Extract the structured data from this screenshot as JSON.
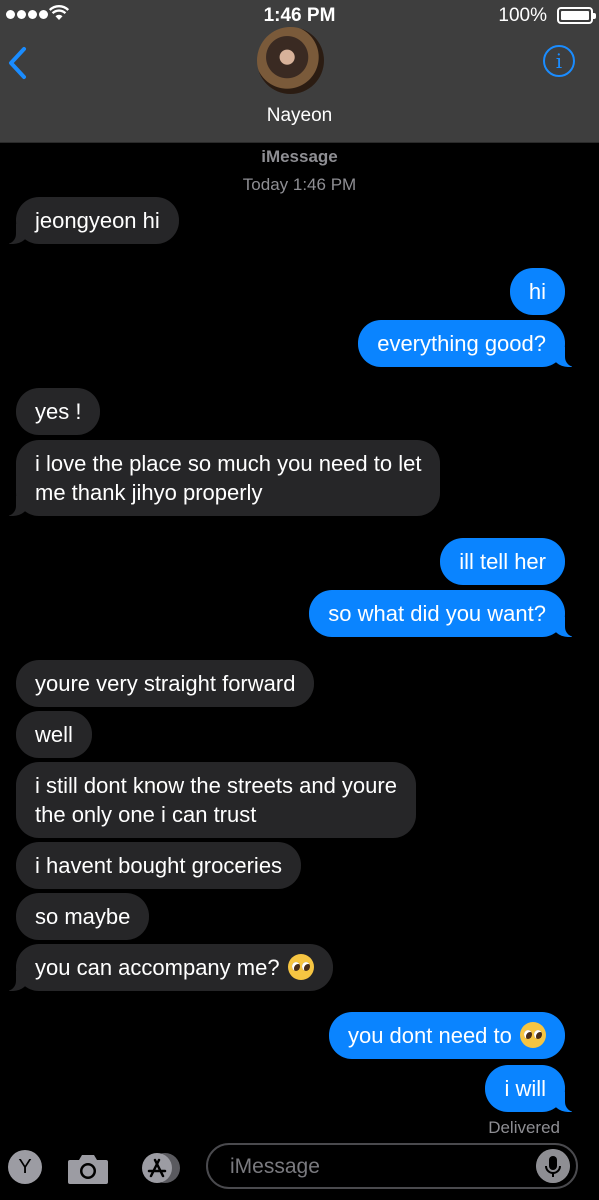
{
  "status_bar": {
    "time": "1:46 PM",
    "battery": "100%"
  },
  "header": {
    "contact_name": "Nayeon",
    "info_label": "i"
  },
  "conversation": {
    "service": "iMessage",
    "timestamp": "Today 1:46 PM",
    "messages": [
      {
        "from": "them",
        "text": "jeongyeon hi"
      },
      {
        "from": "me",
        "text": "hi"
      },
      {
        "from": "me",
        "text": "everything good?"
      },
      {
        "from": "them",
        "text": "yes !"
      },
      {
        "from": "them",
        "text": "i love the place so much you need to let",
        "text2": "me thank jihyo properly"
      },
      {
        "from": "me",
        "text": "ill tell her"
      },
      {
        "from": "me",
        "text": "so what did you want?"
      },
      {
        "from": "them",
        "text": "youre very straight forward"
      },
      {
        "from": "them",
        "text": "well"
      },
      {
        "from": "them",
        "text": "i still dont know the streets and youre",
        "text2": "the only one i can trust"
      },
      {
        "from": "them",
        "text": "i havent bought groceries"
      },
      {
        "from": "them",
        "text": "so maybe"
      },
      {
        "from": "them",
        "text": "you can accompany me?",
        "emoji": "pleading-face"
      },
      {
        "from": "me",
        "text": "you dont need to",
        "emoji": "pleading-face"
      },
      {
        "from": "me",
        "text": "i will"
      }
    ],
    "delivered": "Delivered"
  },
  "input_bar": {
    "apps_label": "Y",
    "placeholder": "iMessage"
  },
  "colors": {
    "sent_bubble": "#0a84ff",
    "received_bubble": "#262628",
    "header_bg": "#3e3e3e",
    "accent": "#1a8cff"
  },
  "icons": [
    "signal-icon",
    "wifi-icon",
    "battery-icon",
    "back-chevron-icon",
    "info-icon",
    "camera-icon",
    "app-store-icon",
    "microphone-icon",
    "pleading-face-emoji"
  ]
}
